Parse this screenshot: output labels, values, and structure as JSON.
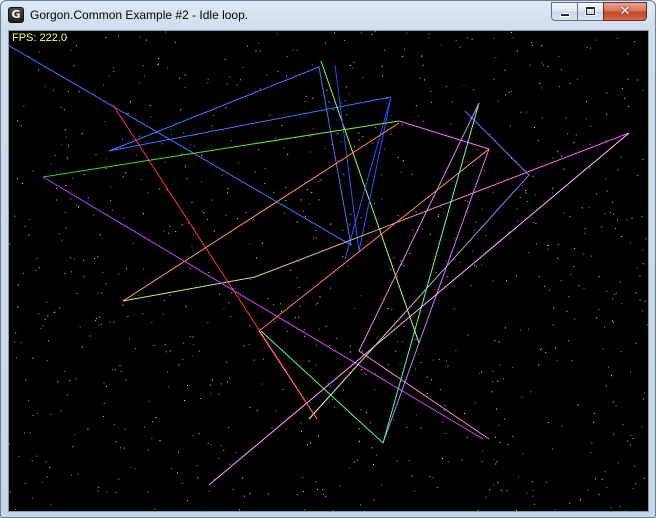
{
  "window": {
    "title": "Gorgon.Common Example #2 - Idle loop.",
    "icon": "gorgon-g-icon",
    "icon_letter": "G",
    "controls": {
      "minimize_icon": "minimize-icon",
      "maximize_icon": "maximize-icon",
      "close_icon": "close-icon",
      "close_glyph": "✕"
    }
  },
  "overlay": {
    "fps_text": "FPS: 222.0",
    "fps_color": "#ffff66"
  },
  "scene": {
    "background_color": "#000000",
    "description_icon": "starfield"
  }
}
